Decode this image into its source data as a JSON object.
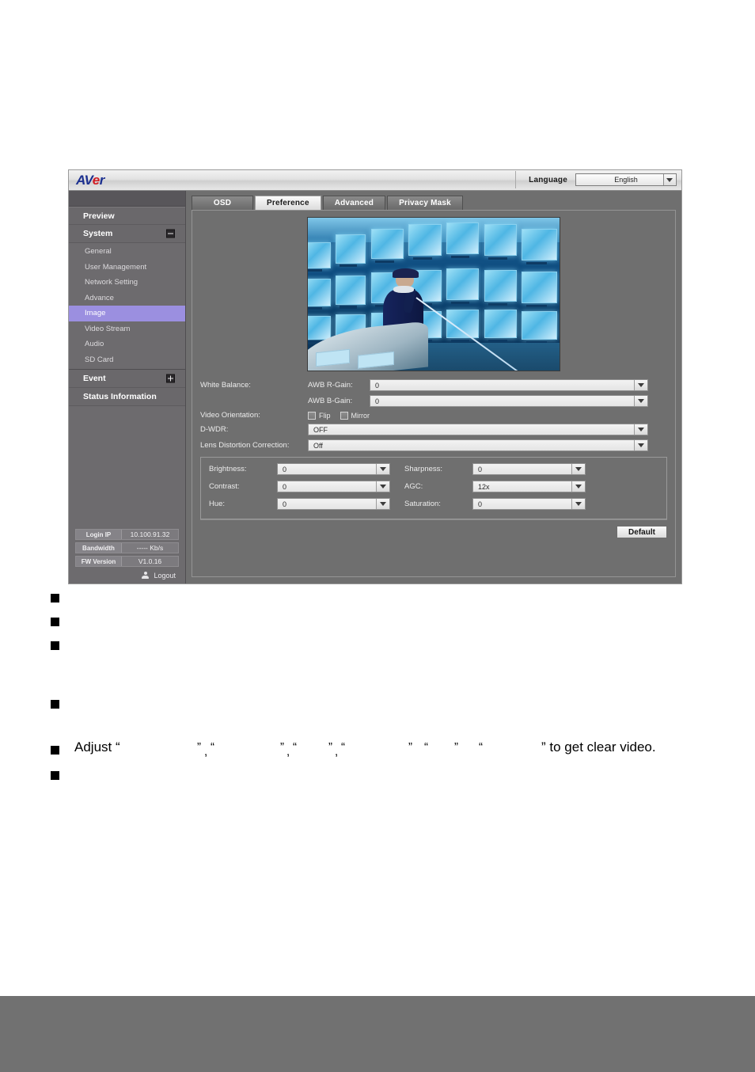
{
  "app": {
    "logo": {
      "part1": "AV",
      "part2": "e",
      "part3": "r"
    },
    "language": {
      "label": "Language",
      "value": "English"
    }
  },
  "sidebar": {
    "groups": [
      {
        "label": "Preview",
        "icon": null
      },
      {
        "label": "System",
        "icon": "collapse-minus-icon"
      },
      {
        "label": "Event",
        "icon": "expand-plus-icon"
      },
      {
        "label": "Status Information",
        "icon": null
      }
    ],
    "system_items": [
      {
        "label": "General",
        "active": false
      },
      {
        "label": "User Management",
        "active": false
      },
      {
        "label": "Network Setting",
        "active": false
      },
      {
        "label": "Advance",
        "active": false
      },
      {
        "label": "Image",
        "active": true
      },
      {
        "label": "Video Stream",
        "active": false
      },
      {
        "label": "Audio",
        "active": false
      },
      {
        "label": "SD Card",
        "active": false
      }
    ],
    "status": [
      {
        "key": "Login IP",
        "value": "10.100.91.32"
      },
      {
        "key": "Bandwidth",
        "value": "----- Kb/s"
      },
      {
        "key": "FW Version",
        "value": "V1.0.16"
      }
    ],
    "logout": "Logout"
  },
  "tabs": [
    {
      "label": "OSD",
      "active": false
    },
    {
      "label": "Preference",
      "active": true
    },
    {
      "label": "Advanced",
      "active": false
    },
    {
      "label": "Privacy Mask",
      "active": false
    }
  ],
  "form": {
    "white_balance_label": "White Balance:",
    "awb_r_gain_label": "AWB R-Gain:",
    "awb_r_gain_value": "0",
    "awb_b_gain_label": "AWB B-Gain:",
    "awb_b_gain_value": "0",
    "video_orientation_label": "Video Orientation:",
    "flip_label": "Flip",
    "mirror_label": "Mirror",
    "dwdr_label": "D-WDR:",
    "dwdr_value": "OFF",
    "ldc_label": "Lens Distortion Correction:",
    "ldc_value": "Off",
    "brightness_label": "Brightness:",
    "brightness_value": "0",
    "sharpness_label": "Sharpness:",
    "sharpness_value": "0",
    "contrast_label": "Contrast:",
    "contrast_value": "0",
    "agc_label": "AGC:",
    "agc_value": "12x",
    "hue_label": "Hue:",
    "hue_value": "0",
    "saturation_label": "Saturation:",
    "saturation_value": "0",
    "default_button": "Default"
  },
  "document": {
    "adjust_prefix": "Adjust “",
    "adjust_suffix": "” to get clear video.",
    "quote_close": "”",
    "quote_open": "“",
    "comma": ","
  },
  "colors": {
    "accent_active_nav": "#9b8fe0",
    "panel_bg": "#6f6f6f",
    "sidebar_bg": "#6d6b6e",
    "logo_blue": "#1b2f8f",
    "logo_red": "#d21b23"
  }
}
